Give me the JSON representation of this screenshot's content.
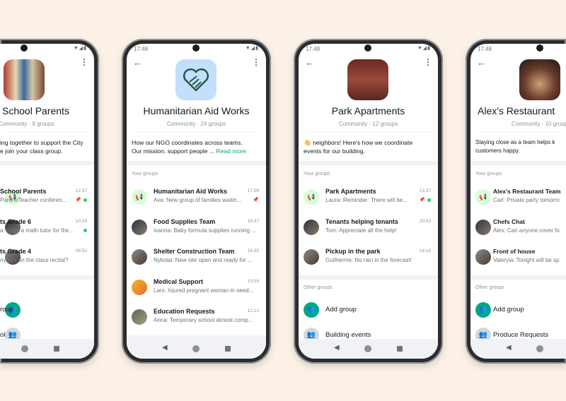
{
  "colors": {
    "background": "#fbf1e6",
    "accent": "#00a884",
    "unread": "#25d366",
    "announcement_bg": "#d9fdd3",
    "community_icon_bg": "#c4dffb"
  },
  "phones": [
    {
      "partial": true,
      "status_time": "",
      "avatar": "books-photo",
      "title": "School Parents",
      "subtitle": "Community · 8 groups",
      "description": [
        "ing together to support the City",
        "e join your class group."
      ],
      "read_more": "",
      "your_groups_label": "",
      "groups": [
        {
          "name": "School Parents",
          "preview": "Parent/Teacher conferen...",
          "time": "12:37",
          "pinned": true,
          "unread": true,
          "avatar": "announcement"
        },
        {
          "name": "ts Grade 6",
          "preview": "a: Have a math tutor for the...",
          "time": "10:18",
          "pinned": false,
          "unread": true,
          "avatar": "photo"
        },
        {
          "name": "ts Grade 4",
          "preview": "ny info on the class recital?",
          "time": "08:52",
          "pinned": false,
          "unread": false,
          "avatar": "photo"
        }
      ],
      "other_groups_label": "",
      "other_groups": [
        {
          "label": "roup",
          "icon": "add-group"
        },
        {
          "label": "ol",
          "icon": "group"
        }
      ]
    },
    {
      "status_time": "17:48",
      "avatar": "heart-handshake",
      "title": "Humanitarian Aid Works",
      "subtitle": "Community · 24 groups",
      "description": [
        "How our NGO coordinates across teams.",
        "Our mission: support people ... "
      ],
      "read_more": "Read more",
      "your_groups_label": "Your groups",
      "groups": [
        {
          "name": "Humanitarian Aid Works",
          "preview": "Ava: New group of families waitin...",
          "time": "17:06",
          "pinned": true,
          "unread": false,
          "avatar": "announcement"
        },
        {
          "name": "Food Supplies Team",
          "preview": "Ivanna: Baby formula supplies running ...",
          "time": "18:37",
          "pinned": false,
          "unread": false,
          "avatar": "photo"
        },
        {
          "name": "Shelter Construction Team",
          "preview": "Nykolai: New site open and ready for ...",
          "time": "16:35",
          "pinned": false,
          "unread": false,
          "avatar": "photo"
        },
        {
          "name": "Medical Support",
          "preview": "Lars: Injured pregnant woman in need...",
          "time": "15:59",
          "pinned": false,
          "unread": false,
          "avatar": "photo"
        },
        {
          "name": "Education Requests",
          "preview": "Anna: Temporary school almost comp...",
          "time": "12:13",
          "pinned": false,
          "unread": false,
          "avatar": "photo"
        }
      ],
      "other_groups_label": "",
      "other_groups": []
    },
    {
      "status_time": "17:48",
      "avatar": "building-photo",
      "title": "Park Apartments",
      "subtitle": "Community · 12 groups",
      "description": [
        "👋 neighbors! Here's how we coordinate",
        "events for our building."
      ],
      "read_more": "",
      "your_groups_label": "Your groups",
      "groups": [
        {
          "name": "Park Apartments",
          "preview": "Laura: Reminder: There will be...",
          "time": "13:37",
          "pinned": true,
          "unread": true,
          "avatar": "announcement"
        },
        {
          "name": "Tenants helping tenants",
          "preview": "Tom: Appreciate all the help!",
          "time": "20:03",
          "pinned": false,
          "unread": false,
          "avatar": "photo"
        },
        {
          "name": "Pickup in the park",
          "preview": "Guilherme: No rain in the forecast!",
          "time": "18:18",
          "pinned": false,
          "unread": false,
          "avatar": "photo"
        }
      ],
      "other_groups_label": "Other groups",
      "other_groups": [
        {
          "label": "Add group",
          "icon": "add-group"
        },
        {
          "label": "Building events",
          "icon": "group"
        }
      ]
    },
    {
      "status_time": "17:48",
      "avatar": "food-photo",
      "title": "Alex's Restaurant",
      "subtitle": "Community · 10 group",
      "description": [
        "Staying close as a team helps k",
        "customers happy."
      ],
      "read_more": "",
      "your_groups_label": "Your groups",
      "groups": [
        {
          "name": "Alex's Restaurant Team",
          "preview": "Carl: Private party tomorro",
          "time": "",
          "pinned": false,
          "unread": false,
          "avatar": "announcement"
        },
        {
          "name": "Chefs Chat",
          "preview": "Alex: Can anyone cover fo",
          "time": "",
          "pinned": false,
          "unread": false,
          "avatar": "photo"
        },
        {
          "name": "Front of house",
          "preview": "Valeryia: Tonight will be sp",
          "time": "",
          "pinned": false,
          "unread": false,
          "avatar": "photo"
        }
      ],
      "other_groups_label": "Other groups",
      "other_groups": [
        {
          "label": "Add group",
          "icon": "add-group"
        },
        {
          "label": "Produce Requests",
          "icon": "group"
        }
      ]
    }
  ]
}
